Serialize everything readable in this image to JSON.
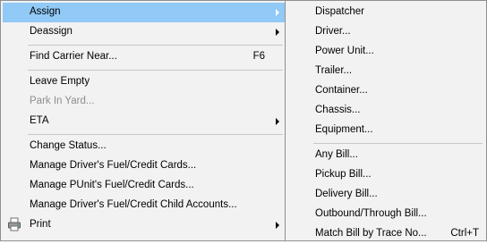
{
  "main_menu": {
    "items": [
      {
        "label": "Assign",
        "shortcut": ""
      },
      {
        "label": "Deassign",
        "shortcut": ""
      },
      {
        "label": "Find Carrier Near...",
        "shortcut": "F6"
      },
      {
        "label": "Leave Empty",
        "shortcut": ""
      },
      {
        "label": "Park In Yard...",
        "shortcut": ""
      },
      {
        "label": "ETA",
        "shortcut": ""
      },
      {
        "label": "Change Status...",
        "shortcut": ""
      },
      {
        "label": "Manage Driver's Fuel/Credit Cards...",
        "shortcut": ""
      },
      {
        "label": "Manage PUnit's Fuel/Credit Cards...",
        "shortcut": ""
      },
      {
        "label": "Manage Driver's Fuel/Credit Child Accounts...",
        "shortcut": ""
      },
      {
        "label": "Print",
        "shortcut": ""
      }
    ]
  },
  "sub_menu": {
    "items": [
      {
        "label": "Dispatcher",
        "shortcut": ""
      },
      {
        "label": "Driver...",
        "shortcut": ""
      },
      {
        "label": "Power Unit...",
        "shortcut": ""
      },
      {
        "label": "Trailer...",
        "shortcut": ""
      },
      {
        "label": "Container...",
        "shortcut": ""
      },
      {
        "label": "Chassis...",
        "shortcut": ""
      },
      {
        "label": "Equipment...",
        "shortcut": ""
      },
      {
        "label": "Any Bill...",
        "shortcut": ""
      },
      {
        "label": "Pickup Bill...",
        "shortcut": ""
      },
      {
        "label": "Delivery Bill...",
        "shortcut": ""
      },
      {
        "label": "Outbound/Through Bill...",
        "shortcut": ""
      },
      {
        "label": "Match Bill by Trace No...",
        "shortcut": "Ctrl+T"
      }
    ]
  },
  "icons": {
    "submenu_arrow": "chevron-right-icon",
    "print": "printer-icon"
  },
  "colors": {
    "highlight": "#91c9f7",
    "menu_bg": "#f2f2f2",
    "disabled_text": "#8d8d8d"
  }
}
